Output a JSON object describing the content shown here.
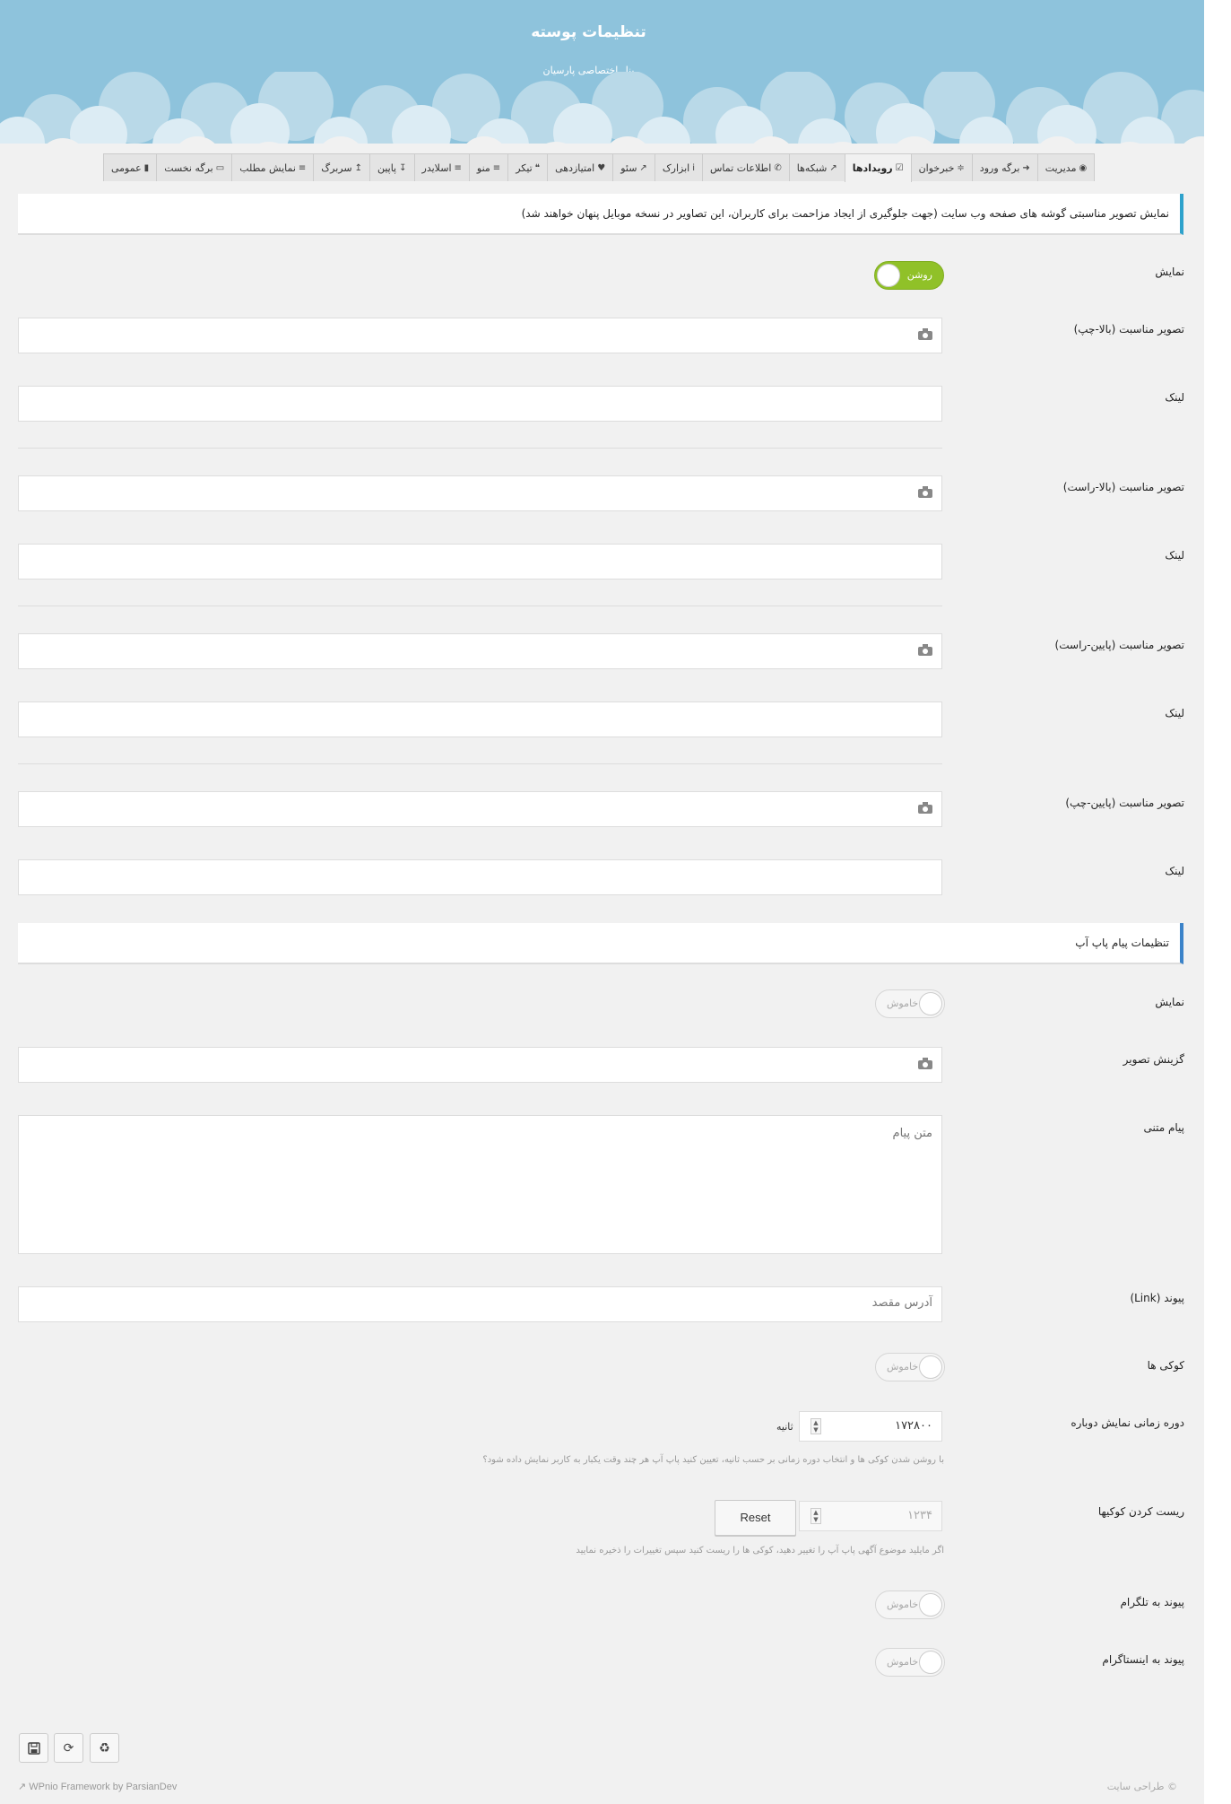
{
  "header": {
    "title": "تنظیمات پوسته",
    "subtitle": "پنل اختصاصی پارسیان"
  },
  "tabs": [
    {
      "label": "عمومی",
      "icon": "book-icon"
    },
    {
      "label": "برگه نخست",
      "icon": "desktop-icon"
    },
    {
      "label": "نمایش مطلب",
      "icon": "list-icon"
    },
    {
      "label": "سربرگ",
      "icon": "arrow-up-icon"
    },
    {
      "label": "پاپین",
      "icon": "arrow-down-icon"
    },
    {
      "label": "اسلایدر",
      "icon": "sliders-icon"
    },
    {
      "label": "منو",
      "icon": "bars-icon"
    },
    {
      "label": "تیکر",
      "icon": "quote-icon"
    },
    {
      "label": "امتیازدهی",
      "icon": "heart-icon"
    },
    {
      "label": "سئو",
      "icon": "chart-icon"
    },
    {
      "label": "ابزارک",
      "icon": "info-icon"
    },
    {
      "label": "اطلاعات تماس",
      "icon": "phone-icon"
    },
    {
      "label": "شبکه‌ها",
      "icon": "share-icon"
    },
    {
      "label": "رویدادها",
      "icon": "calendar-icon"
    },
    {
      "label": "خبرخوان",
      "icon": "rss-icon"
    },
    {
      "label": "برگه ورود",
      "icon": "sign-in-icon"
    },
    {
      "label": "مدیریت",
      "icon": "binoculars-icon"
    }
  ],
  "active_tab": "رویدادها",
  "corner_section": {
    "notice": "نمایش تصویر مناسبتی گوشه های صفحه وب سایت (جهت جلوگیری از ایجاد مزاحمت برای کاربران، این تصاویر در نسخه موبایل پنهان خواهند شد)",
    "show_label": "نمایش",
    "show_toggle": "روشن",
    "img_top_left_label": "تصویر مناسبت (بالا-چپ)",
    "link_label": "لینک",
    "img_top_right_label": "تصویر مناسبت (بالا-راست)",
    "img_bottom_right_label": "تصویر مناسبت (پایین-راست)",
    "img_bottom_left_label": "تصویر مناسبت (پایین-چپ)"
  },
  "popup_section": {
    "notice": "تنظیمات پیام پاپ آپ",
    "show_label": "نمایش",
    "show_toggle": "خاموش",
    "image_label": "گزینش تصویر",
    "message_label": "پیام متنی",
    "message_placeholder": "متن پیام",
    "link_label": "پیوند (Link)",
    "link_placeholder": "آدرس مقصد",
    "cookies_label": "کوکی ها",
    "cookies_toggle": "خاموش",
    "period_label": "دوره زمانی نمایش دوباره",
    "period_value": "۱۷۲۸۰۰",
    "period_unit": "ثانیه",
    "period_hint": "با روشن شدن کوکی ها و انتخاب دوره زمانی بر حسب ثانیه، تعیین کنید پاپ آپ هر چند وقت یکبار به کاربر نمایش داده شود؟",
    "reset_label": "ریست کردن کوکیها",
    "reset_value": "۱۲۳۴",
    "reset_button": "Reset",
    "reset_hint": "اگر مایلید موضوع آگهی پاپ آپ را تغییر دهید، کوکی ها را ریست کنید سپس تغییرات را ذخیره نمایید",
    "telegram_label": "پیوند به تلگرام",
    "telegram_toggle": "خاموش",
    "instagram_label": "پیوند به اینستاگرام",
    "instagram_toggle": "خاموش"
  },
  "footer": {
    "credit": "WPnio Framework by ParsianDev",
    "copyright": "© طراحی سایت"
  },
  "colors": {
    "header_bg": "#8ec3dc",
    "toggle_on": "#90c128",
    "notice_border": "#2ea2cc"
  }
}
